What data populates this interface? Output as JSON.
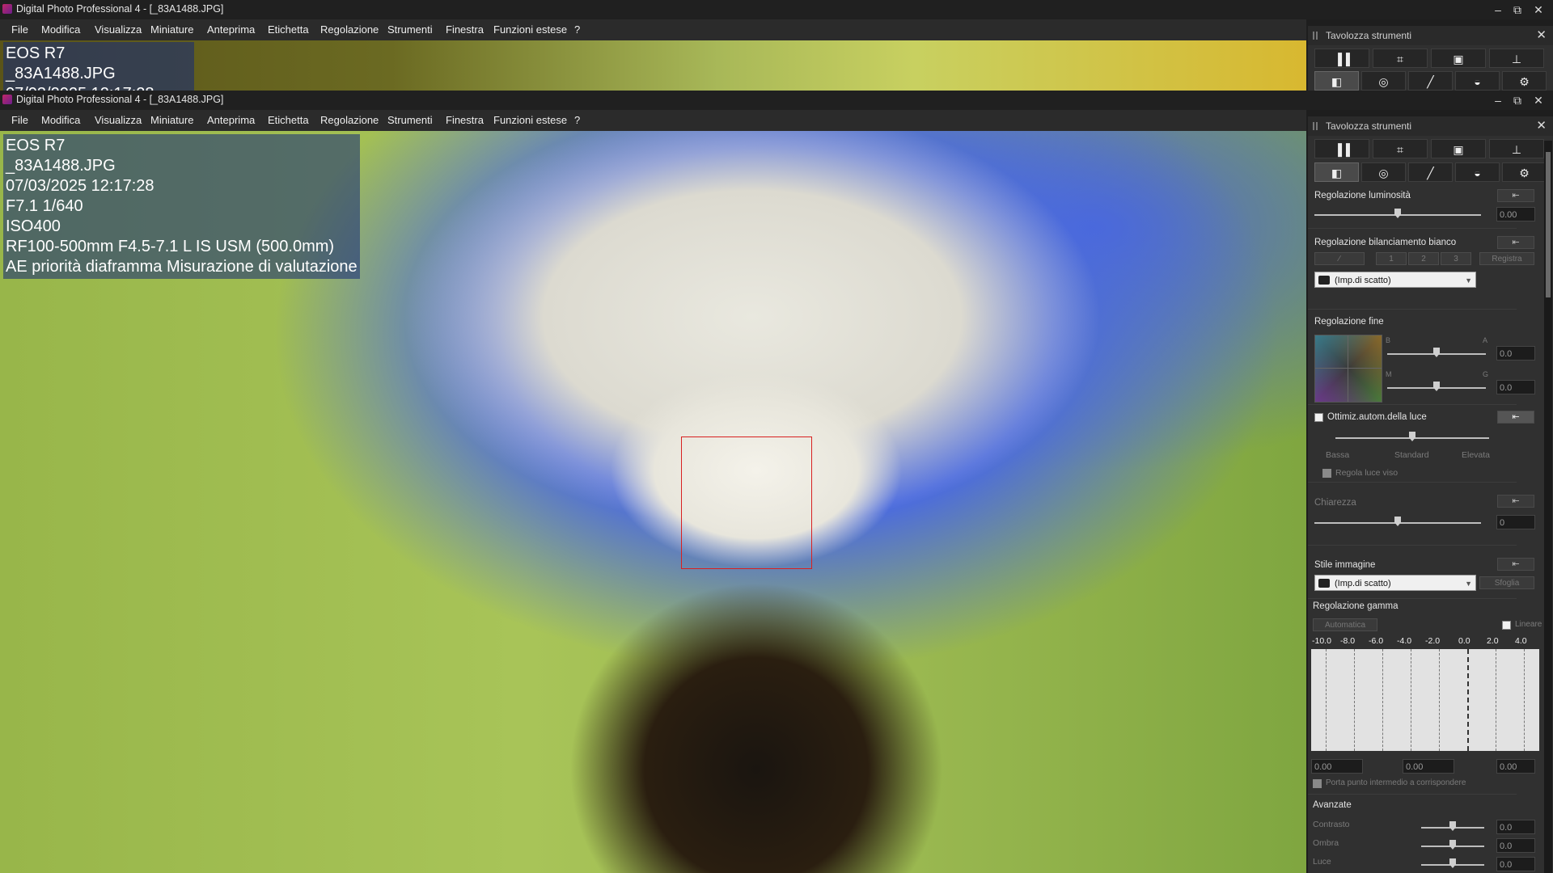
{
  "app": {
    "title": "Digital Photo Professional 4 - [_83A1488.JPG]",
    "min_icon": "minimize-icon",
    "restore_icon": "restore-icon",
    "close_icon": "close-icon"
  },
  "menu": [
    "File",
    "Modifica",
    "Visualizza",
    "Miniature",
    "Anteprima",
    "Etichetta",
    "Regolazione",
    "Strumenti",
    "Finestra",
    "Funzioni estese",
    "?"
  ],
  "info": {
    "camera": "EOS R7",
    "filename": "_83A1488.JPG",
    "datetime": "07/03/2025 12:17:28",
    "exposure": "F7.1 1/640",
    "iso": "ISO400",
    "lens": "RF100-500mm F4.5-7.1 L IS USM (500.0mm)",
    "mode": "AE priorità diaframma Misurazione di valutazione"
  },
  "palette": {
    "title": "Tavolozza strumenti",
    "tools_row1": [
      "tool-basic-icon",
      "tool-crop-icon",
      "tool-dust-icon",
      "tool-stamp-icon"
    ],
    "tools_row2": [
      "tool-basic-adjust-icon",
      "tool-lens-icon",
      "tool-curve-icon",
      "tool-color-icon",
      "tool-settings-icon"
    ],
    "brightness": {
      "label": "Regolazione luminosità",
      "value": "0.00",
      "level": 0.5
    },
    "wb": {
      "label": "Regolazione bilanciamento bianco",
      "b1": "1",
      "b2": "2",
      "b3": "3",
      "register": "Registra",
      "select": "(Imp.di scatto)"
    },
    "fine": {
      "label": "Regolazione fine",
      "B": "B",
      "A": "A",
      "M": "M",
      "G": "G",
      "v1": "0.0",
      "v2": "0.0"
    },
    "alo": {
      "label": "Ottimiz.autom.della luce",
      "low": "Bassa",
      "std": "Standard",
      "high": "Elevata",
      "face": "Regola luce viso",
      "level": 0.5
    },
    "clarity": {
      "label": "Chiarezza",
      "value": "0",
      "level": 0.5
    },
    "style": {
      "label": "Stile immagine",
      "select": "(Imp.di scatto)",
      "browse": "Sfoglia"
    },
    "gamma": {
      "label": "Regolazione gamma",
      "auto": "Automatica",
      "linear": "Lineare",
      "ticks": [
        "-10.0",
        "-8.0",
        "-6.0",
        "-4.0",
        "-2.0",
        "0.0",
        "2.0",
        "4.0"
      ],
      "v1": "0.00",
      "v2": "0.00",
      "v3": "0.00",
      "midpoint": "Porta punto intermedio a corrispondere"
    },
    "advanced": {
      "label": "Avanzate",
      "contrast": "Contrasto",
      "shadow": "Ombra",
      "light": "Luce",
      "v1": "0.0",
      "v2": "0.0",
      "v3": "0.0"
    }
  }
}
